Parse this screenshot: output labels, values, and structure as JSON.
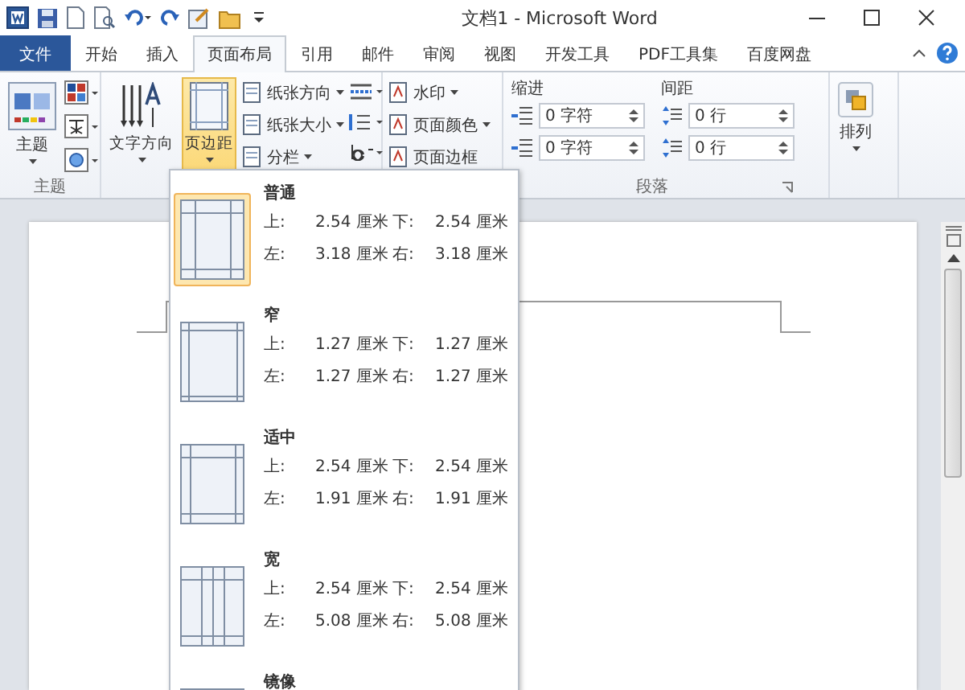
{
  "window": {
    "title": "文档1 - Microsoft Word"
  },
  "tabs": [
    {
      "label": "文件",
      "kind": "file",
      "selected": false
    },
    {
      "label": "开始",
      "kind": "tab",
      "selected": false
    },
    {
      "label": "插入",
      "kind": "tab",
      "selected": false
    },
    {
      "label": "页面布局",
      "kind": "tab",
      "selected": true
    },
    {
      "label": "引用",
      "kind": "tab",
      "selected": false
    },
    {
      "label": "邮件",
      "kind": "tab",
      "selected": false
    },
    {
      "label": "审阅",
      "kind": "tab",
      "selected": false
    },
    {
      "label": "视图",
      "kind": "tab",
      "selected": false
    },
    {
      "label": "开发工具",
      "kind": "tab",
      "selected": false
    },
    {
      "label": "PDF工具集",
      "kind": "tab",
      "selected": false
    },
    {
      "label": "百度网盘",
      "kind": "tab",
      "selected": false
    }
  ],
  "ribbon": {
    "theme_group": {
      "button": "主题",
      "label": "主题"
    },
    "page_setup": {
      "text_direction": "文字方向",
      "margins": {
        "label": "页边距",
        "selected": true
      },
      "small_buttons": [
        "纸张方向",
        "纸张大小",
        "分栏"
      ]
    },
    "background": {
      "buttons": [
        "水印",
        "页面颜色",
        "页面边框"
      ]
    },
    "paragraph": {
      "label": "段落",
      "indent_label": "缩进",
      "spacing_label": "间距",
      "indent_fields": [
        "0 字符",
        "0 字符"
      ],
      "spacing_fields": [
        "0 行",
        "0 行"
      ]
    },
    "arrange": {
      "button": "排列"
    }
  },
  "margins_menu": {
    "items": [
      {
        "name": "普通",
        "kind": "normal",
        "selected": true,
        "rows": [
          [
            {
              "label": "上:",
              "value": "2.54 厘米"
            },
            {
              "label": "下:",
              "value": "2.54 厘米"
            }
          ],
          [
            {
              "label": "左:",
              "value": "3.18 厘米"
            },
            {
              "label": "右:",
              "value": "3.18 厘米"
            }
          ]
        ]
      },
      {
        "name": "窄",
        "kind": "narrow",
        "selected": false,
        "rows": [
          [
            {
              "label": "上:",
              "value": "1.27 厘米"
            },
            {
              "label": "下:",
              "value": "1.27 厘米"
            }
          ],
          [
            {
              "label": "左:",
              "value": "1.27 厘米"
            },
            {
              "label": "右:",
              "value": "1.27 厘米"
            }
          ]
        ]
      },
      {
        "name": "适中",
        "kind": "moderate",
        "selected": false,
        "rows": [
          [
            {
              "label": "上:",
              "value": "2.54 厘米"
            },
            {
              "label": "下:",
              "value": "2.54 厘米"
            }
          ],
          [
            {
              "label": "左:",
              "value": "1.91 厘米"
            },
            {
              "label": "右:",
              "value": "1.91 厘米"
            }
          ]
        ]
      },
      {
        "name": "宽",
        "kind": "wide",
        "selected": false,
        "rows": [
          [
            {
              "label": "上:",
              "value": "2.54 厘米"
            },
            {
              "label": "下:",
              "value": "2.54 厘米"
            }
          ],
          [
            {
              "label": "左:",
              "value": "5.08 厘米"
            },
            {
              "label": "右:",
              "value": "5.08 厘米"
            }
          ]
        ]
      },
      {
        "name": "镜像",
        "kind": "mirrored",
        "selected": false
      }
    ]
  }
}
